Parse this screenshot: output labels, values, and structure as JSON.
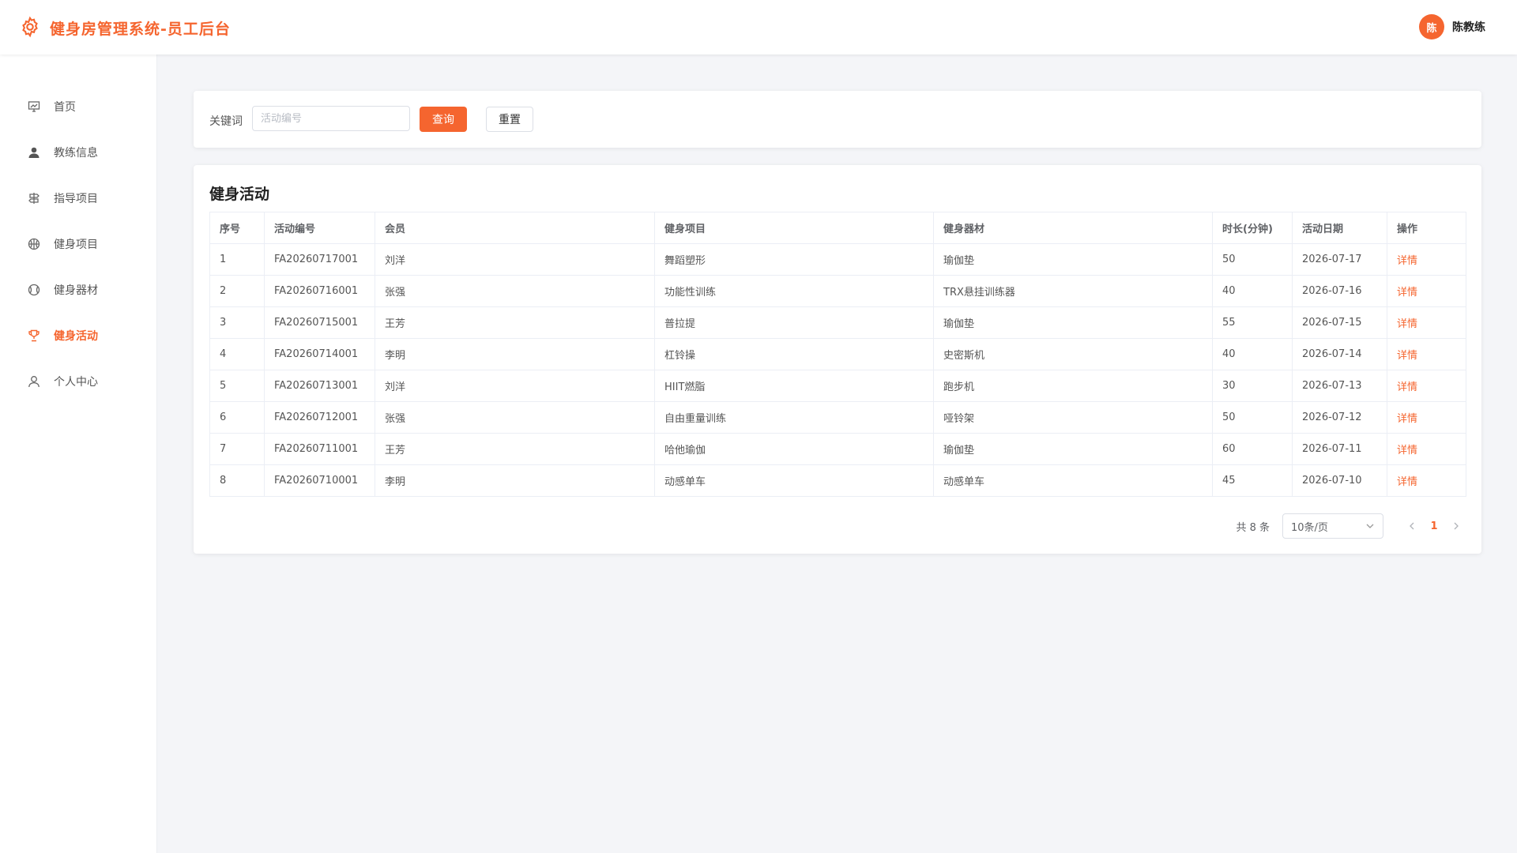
{
  "header": {
    "title": "健身房管理系统-员工后台",
    "avatar_text": "陈",
    "user_name": "陈教练"
  },
  "colors": {
    "accent": "#f5652f"
  },
  "sidebar": {
    "items": [
      {
        "label": "首页",
        "icon": "dashboard-icon",
        "active": false
      },
      {
        "label": "教练信息",
        "icon": "user-icon",
        "active": false
      },
      {
        "label": "指导项目",
        "icon": "signpost-icon",
        "active": false
      },
      {
        "label": "健身项目",
        "icon": "basketball-icon",
        "active": false
      },
      {
        "label": "健身器材",
        "icon": "baseball-icon",
        "active": false
      },
      {
        "label": "健身活动",
        "icon": "trophy-icon",
        "active": true
      },
      {
        "label": "个人中心",
        "icon": "user-outline-icon",
        "active": false
      }
    ]
  },
  "search": {
    "label": "关键词",
    "placeholder": "活动编号",
    "value": "",
    "query_label": "查询",
    "reset_label": "重置"
  },
  "table": {
    "title": "健身活动",
    "columns": [
      "序号",
      "活动编号",
      "会员",
      "健身项目",
      "健身器材",
      "时长(分钟)",
      "活动日期",
      "操作"
    ],
    "rows": [
      [
        "1",
        "FA20260717001",
        "刘洋",
        "舞蹈塑形",
        "瑜伽垫",
        "50",
        "2026-07-17",
        "详情"
      ],
      [
        "2",
        "FA20260716001",
        "张强",
        "功能性训练",
        "TRX悬挂训练器",
        "40",
        "2026-07-16",
        "详情"
      ],
      [
        "3",
        "FA20260715001",
        "王芳",
        "普拉提",
        "瑜伽垫",
        "55",
        "2026-07-15",
        "详情"
      ],
      [
        "4",
        "FA20260714001",
        "李明",
        "杠铃操",
        "史密斯机",
        "40",
        "2026-07-14",
        "详情"
      ],
      [
        "5",
        "FA20260713001",
        "刘洋",
        "HIIT燃脂",
        "跑步机",
        "30",
        "2026-07-13",
        "详情"
      ],
      [
        "6",
        "FA20260712001",
        "张强",
        "自由重量训练",
        "哑铃架",
        "50",
        "2026-07-12",
        "详情"
      ],
      [
        "7",
        "FA20260711001",
        "王芳",
        "哈他瑜伽",
        "瑜伽垫",
        "60",
        "2026-07-11",
        "详情"
      ],
      [
        "8",
        "FA20260710001",
        "李明",
        "动感单车",
        "动感单车",
        "45",
        "2026-07-10",
        "详情"
      ]
    ]
  },
  "pagination": {
    "total_text": "共 8 条",
    "page_size": "10条/页",
    "current_page": "1"
  }
}
